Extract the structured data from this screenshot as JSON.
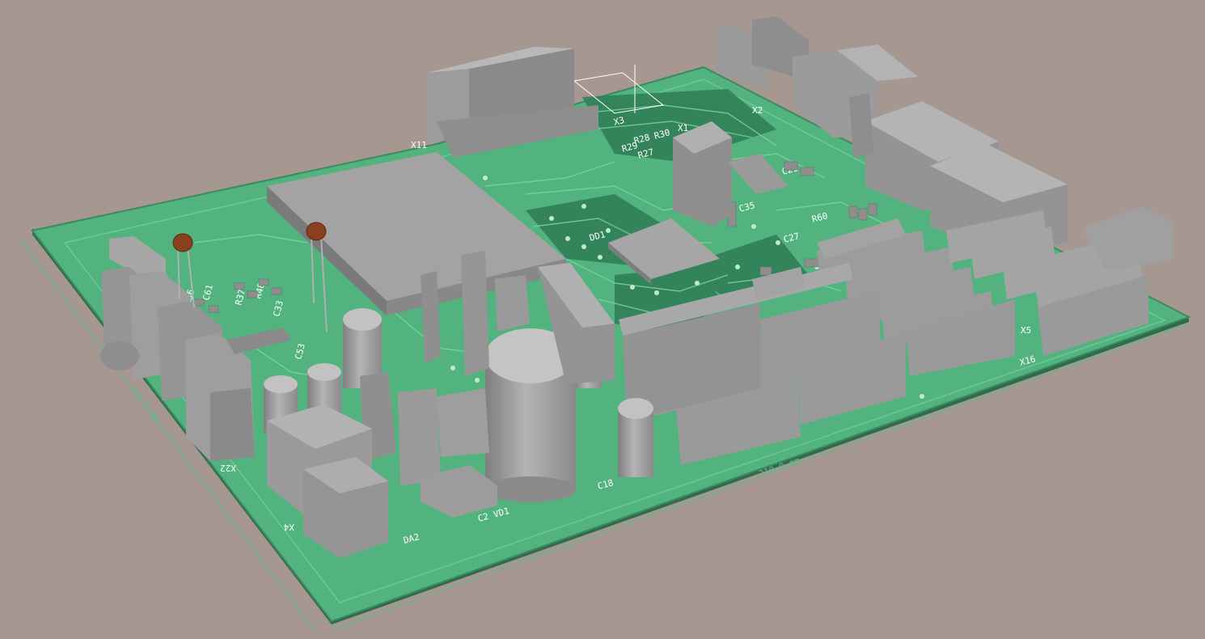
{
  "scene": {
    "background": "#a69790",
    "board_top_color": "#52b37e",
    "board_edge_color": "#2f6b4d",
    "component_color": "#9d9d9d"
  },
  "labels": {
    "x11": "X11",
    "x3": "X3",
    "x1": "X1",
    "x2": "X2",
    "x5": "X5",
    "x16": "X16",
    "x4": "X4",
    "x22": "X22",
    "da2": "DA2",
    "dd1": "DD1",
    "c2_vd1": "C2 VD1",
    "c18": "C18",
    "r28": "R28",
    "r29": "R29",
    "r30": "R30",
    "r27": "R27",
    "c35": "C35",
    "c21": "C21",
    "r60": "R60",
    "c33": "C33",
    "c53": "C53",
    "r36": "R36",
    "c61": "C61",
    "r37": "R37",
    "r48": "R48",
    "c27": "C27"
  },
  "dimensions": {
    "left_dim": "115.2 mm",
    "bottom_dim": "210.0 mm"
  }
}
